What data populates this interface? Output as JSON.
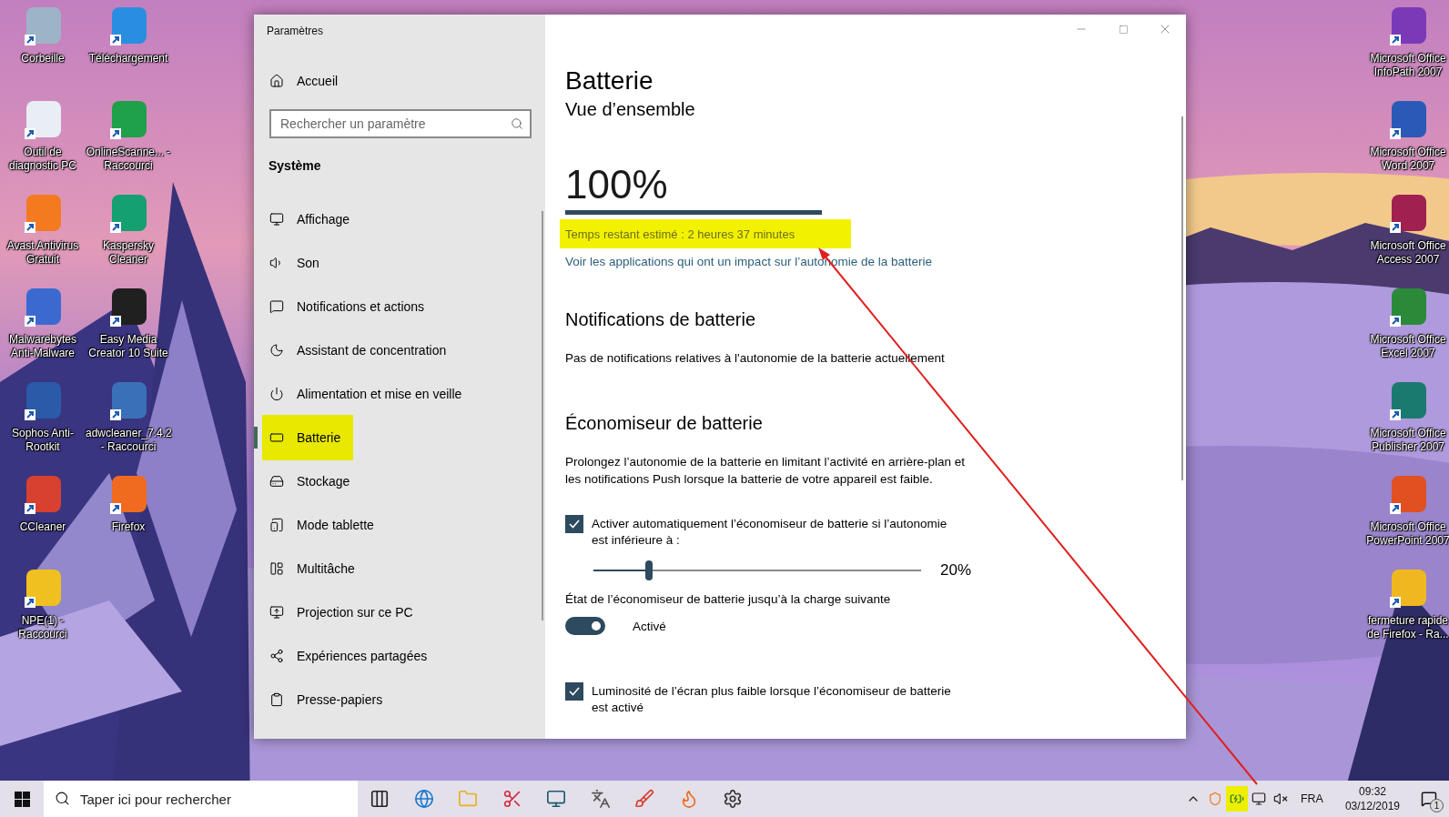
{
  "desktop": {
    "left_icons": [
      {
        "label": "Corbeille",
        "color": "#9db4c8"
      },
      {
        "label": "Téléchargement",
        "color": "#2a8ee0"
      },
      {
        "label": "Outil de diagnostic PC",
        "color": "#e8eef4"
      },
      {
        "label": "OnlineScanne... - Raccourci",
        "color": "#1fa04a"
      },
      {
        "label": "Avast Antivirus Gratuit",
        "color": "#f47a20"
      },
      {
        "label": "Kaspersky Cleaner",
        "color": "#14a070"
      },
      {
        "label": "Malwarebytes Anti-Malware",
        "color": "#3a6ad0"
      },
      {
        "label": "Easy Media Creator 10 Suite",
        "color": "#202020"
      },
      {
        "label": "Sophos Anti-Rootkit",
        "color": "#2a5aa8"
      },
      {
        "label": "adwcleaner_7.4.2 - Raccourci",
        "color": "#3a70b8"
      },
      {
        "label": "CCleaner",
        "color": "#d84030"
      },
      {
        "label": "Firefox",
        "color": "#f06a20"
      },
      {
        "label": "NPE(1) - Raccourci",
        "color": "#f0c020"
      }
    ],
    "right_icons": [
      {
        "label": "Microsoft Office InfoPath 2007",
        "color": "#7a3ab8"
      },
      {
        "label": "Microsoft Office Word 2007",
        "color": "#2a5ab8"
      },
      {
        "label": "Microsoft Office Access 2007",
        "color": "#a02050"
      },
      {
        "label": "Microsoft Office Excel 2007",
        "color": "#2a8a3a"
      },
      {
        "label": "Microsoft Office Publisher 2007",
        "color": "#1a7a70"
      },
      {
        "label": "Microsoft Office PowerPoint 2007",
        "color": "#e05020"
      },
      {
        "label": "fermeture rapide de  Firefox - Ra...",
        "color": "#f0b820"
      }
    ]
  },
  "window": {
    "title": "Paramètres",
    "home": "Accueil",
    "search": {
      "placeholder": "Rechercher un paramètre"
    },
    "section": "Système",
    "nav": [
      {
        "label": "Affichage",
        "kind": "display",
        "selected": false
      },
      {
        "label": "Son",
        "kind": "sound",
        "selected": false
      },
      {
        "label": "Notifications et actions",
        "kind": "notifications",
        "selected": false
      },
      {
        "label": "Assistant de concentration",
        "kind": "focus",
        "selected": false
      },
      {
        "label": "Alimentation et mise en veille",
        "kind": "power",
        "selected": false
      },
      {
        "label": "Batterie",
        "kind": "battery",
        "selected": true
      },
      {
        "label": "Stockage",
        "kind": "storage",
        "selected": false
      },
      {
        "label": "Mode tablette",
        "kind": "tablet",
        "selected": false
      },
      {
        "label": "Multitâche",
        "kind": "multitask",
        "selected": false
      },
      {
        "label": "Projection sur ce PC",
        "kind": "projection",
        "selected": false
      },
      {
        "label": "Expériences partagées",
        "kind": "shared",
        "selected": false
      },
      {
        "label": "Presse-papiers",
        "kind": "clipboard",
        "selected": false
      }
    ]
  },
  "page": {
    "title": "Batterie",
    "overview": {
      "heading": "Vue d’ensemble",
      "percent": "100%",
      "estimate": {
        "text": "Temps restant estimé : 2 heures 37 minutes",
        "highlighted": true
      },
      "link": "Voir les applications qui ont un impact sur l’autonomie de la batterie"
    },
    "notifications": {
      "heading": "Notifications de batterie",
      "text": "Pas de notifications relatives à l'autonomie de la batterie actuellement"
    },
    "saver": {
      "heading": "Économiseur de batterie",
      "description": "Prolongez l’autonomie de la batterie en limitant l’activité en arrière-plan et les notifications Push lorsque la batterie de votre appareil est faible.",
      "auto": {
        "label": "Activer automatiquement l’économiseur de batterie si l’autonomie est inférieure à :",
        "checked": true
      },
      "threshold": {
        "level": 0.17,
        "reading": "20%"
      },
      "state_label": "État de l’économiseur de batterie jusqu’à la charge suivante",
      "toggle": {
        "label": "Activé",
        "on": true
      },
      "dim": {
        "label": "Luminosité de l’écran plus faible lorsque l’économiseur de batterie est activé",
        "checked": true
      }
    }
  },
  "taskbar": {
    "search": {
      "placeholder": "Taper ici pour rechercher"
    },
    "apps": [
      {
        "kind": "taskview"
      },
      {
        "kind": "edge"
      },
      {
        "kind": "explorer"
      },
      {
        "kind": "snipping"
      },
      {
        "kind": "monitor"
      },
      {
        "kind": "language"
      },
      {
        "kind": "ccleaner"
      },
      {
        "kind": "firefox"
      },
      {
        "kind": "settings"
      }
    ],
    "tray": [
      {
        "kind": "chevron",
        "highlighted": false
      },
      {
        "kind": "avast",
        "highlighted": false
      },
      {
        "kind": "battery",
        "highlighted": true
      },
      {
        "kind": "network",
        "highlighted": false
      },
      {
        "kind": "volume",
        "highlighted": false
      }
    ],
    "language": "FRA",
    "time": "09:32",
    "date": "03/12/2019",
    "notifications": "1"
  }
}
